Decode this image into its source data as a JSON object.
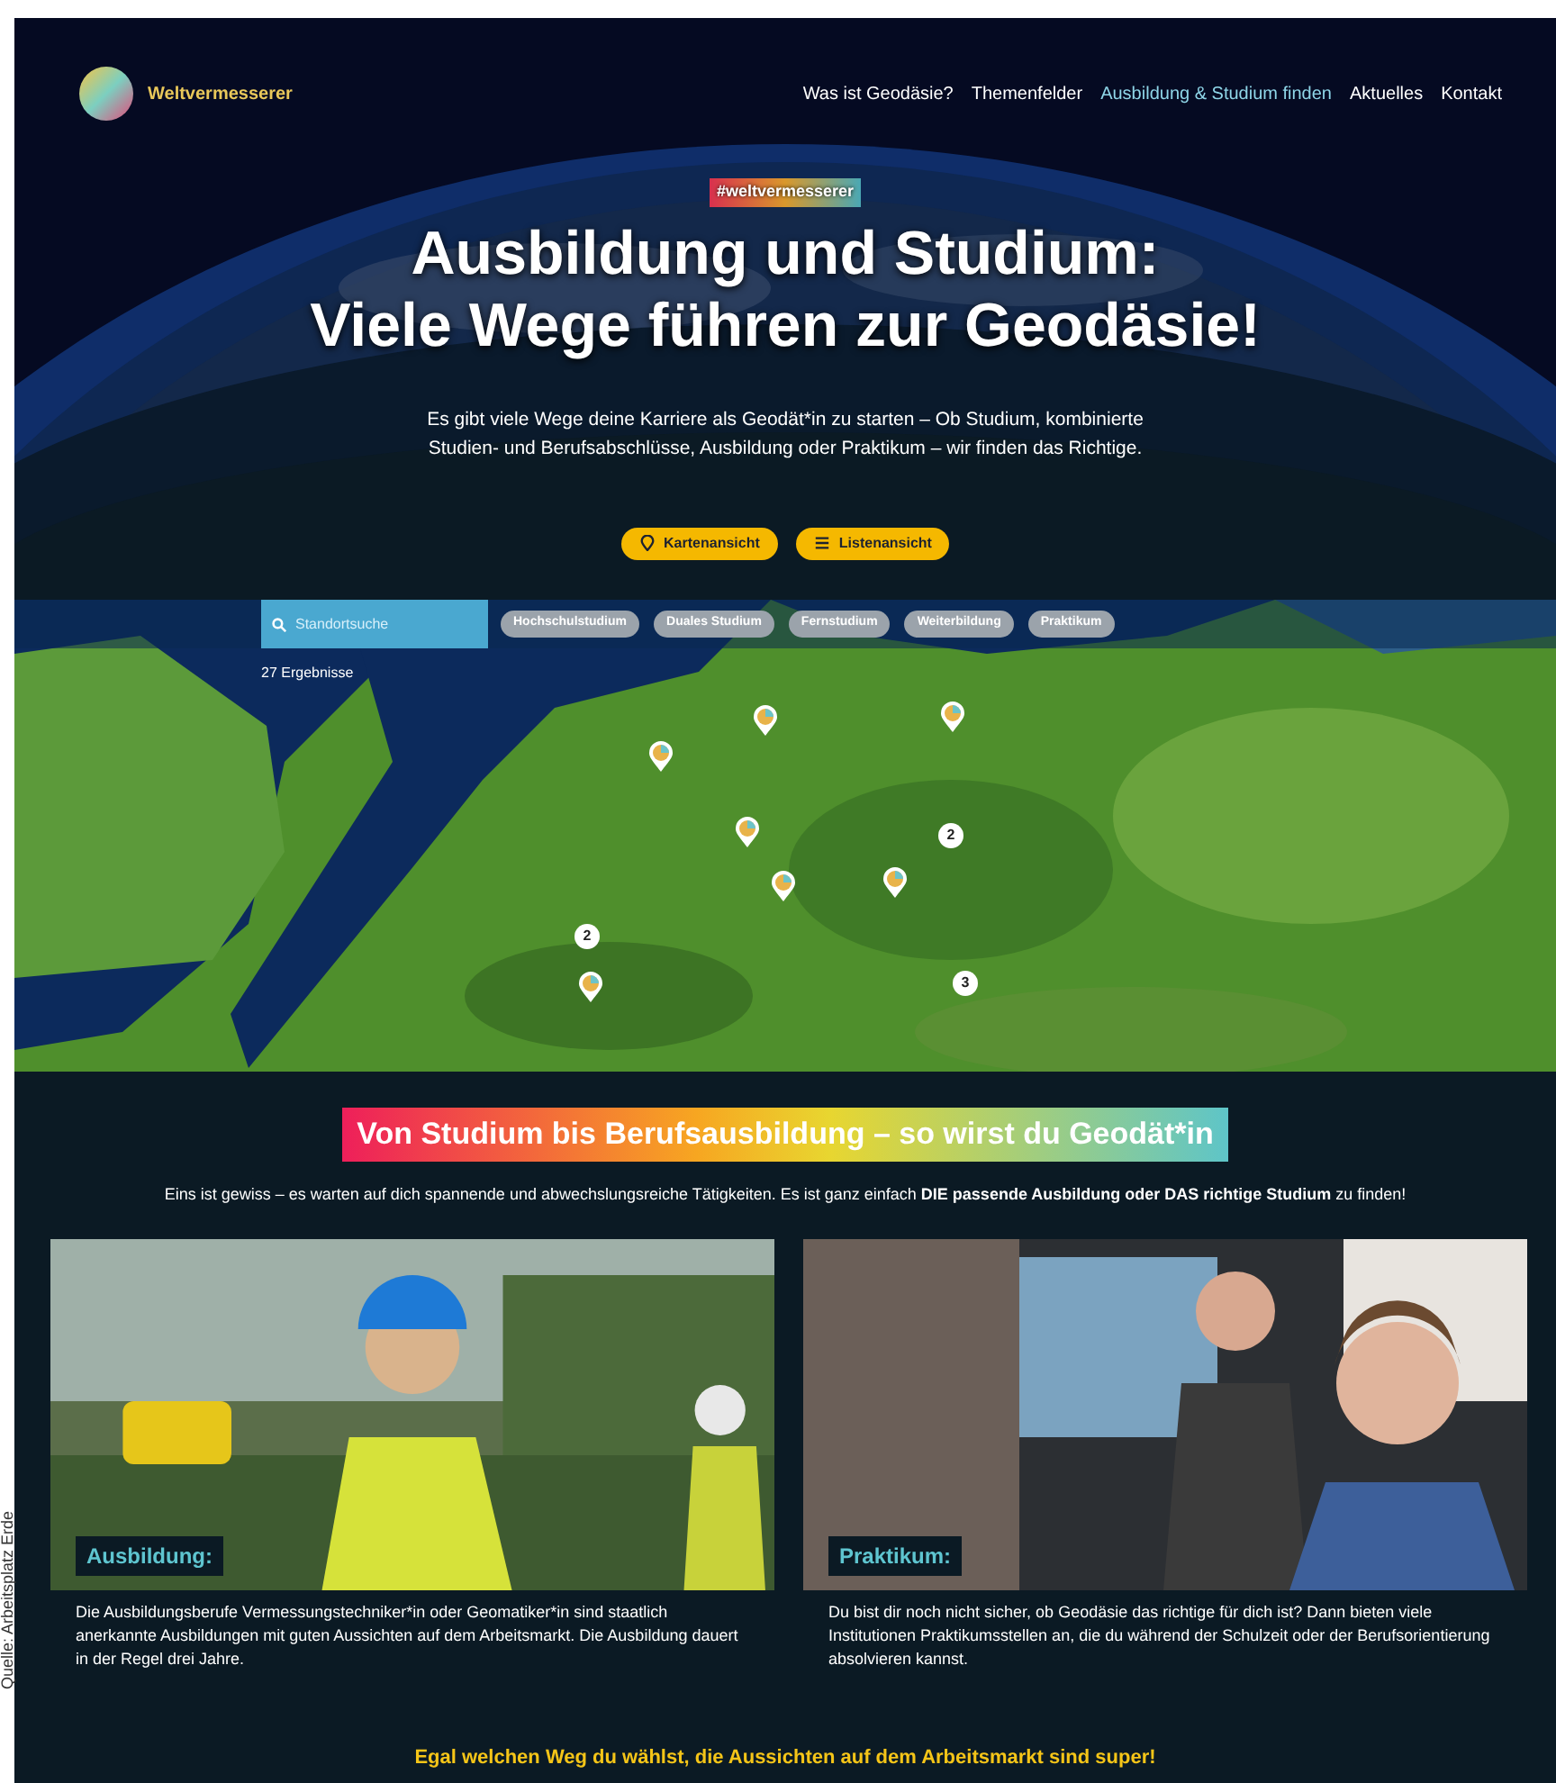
{
  "credit": "Quelle: Arbeitsplatz Erde",
  "header": {
    "logo": "Weltvermesserer",
    "nav": [
      {
        "label": "Was ist Geodäsie?",
        "selected": false
      },
      {
        "label": "Themenfelder",
        "selected": false
      },
      {
        "label": "Ausbildung & Studium finden",
        "selected": true
      },
      {
        "label": "Aktuelles",
        "selected": false
      },
      {
        "label": "Kontakt",
        "selected": false
      }
    ]
  },
  "hero": {
    "tag": "#weltvermesserer",
    "title_lines": [
      "Ausbildung und Studium:",
      "Viele Wege führen zur Geodäsie!"
    ],
    "intro": "Es gibt viele Wege deine Karriere als Geodät*in zu starten – Ob Studium, kombinierte Studien- und Berufsabschlüsse, Ausbildung oder Praktikum – wir finden das Richtige.",
    "views": [
      {
        "label": "Kartenansicht",
        "kind": "map"
      },
      {
        "label": "Listenansicht",
        "kind": "list"
      }
    ]
  },
  "map": {
    "search": {
      "placeholder": "Standortsuche"
    },
    "filters": [
      "Hochschulstudium",
      "Duales Studium",
      "Fernstudium",
      "Weiterbildung",
      "Praktikum"
    ],
    "results": "27 Ergebnisse",
    "markers": [
      {
        "kind": "pin"
      },
      {
        "kind": "pin"
      },
      {
        "kind": "pin"
      },
      {
        "kind": "pin"
      },
      {
        "kind": "pin"
      },
      {
        "kind": "pin"
      },
      {
        "kind": "pin"
      },
      {
        "kind": "cluster",
        "count": "2"
      },
      {
        "kind": "cluster",
        "count": "2"
      },
      {
        "kind": "cluster",
        "count": "3"
      }
    ]
  },
  "section": {
    "heading": "Von Studium bis Berufsausbildung – so wirst du Geodät*in",
    "intro": "Eins ist gewiss – es warten auf dich spannende und abwechslungsreiche Tätigkeiten. Es ist ganz einfach **DIE passende Ausbildung oder DAS richtige Studium** zu finden!",
    "cards": [
      {
        "label": "Ausbildung:",
        "text": "Die Ausbildungsberufe Vermessungstechniker*in oder Geomatiker*in sind staatlich anerkannte Ausbildungen mit guten Aussichten auf dem Arbeitsmarkt. Die Ausbildung dauert in der Regel drei Jahre."
      },
      {
        "label": "Praktikum:",
        "text": "Du bist dir noch nicht sicher, ob Geodäsie das richtige für dich ist? Dann bieten viele Institutionen Praktikumsstellen an, die du während der Schulzeit oder der Berufsorientierung absolvieren kannst."
      }
    ],
    "closing": "Egal welchen Weg du wählst, die Aussichten auf dem Arbeitsmarkt sind super!"
  }
}
